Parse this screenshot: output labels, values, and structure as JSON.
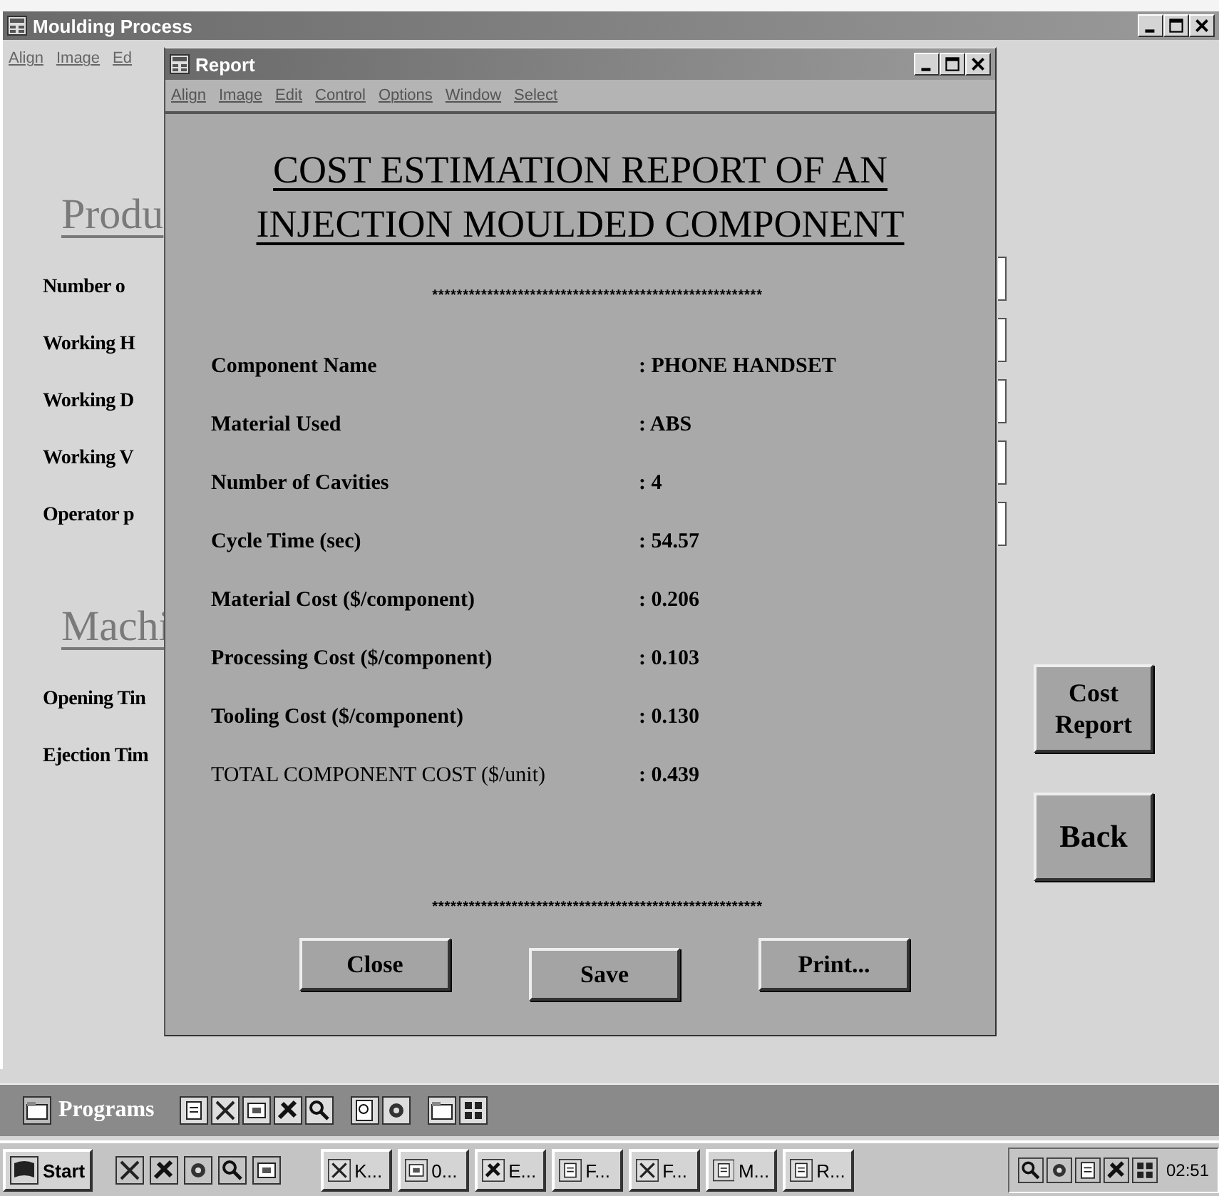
{
  "main_window": {
    "title": "Moulding Process",
    "menu": [
      "Align",
      "Image",
      "Ed"
    ],
    "sections": [
      {
        "heading": "Produ",
        "labels": [
          "Number o",
          "Working H",
          "Working D",
          "Working V",
          "Operator p"
        ]
      },
      {
        "heading": "Machi",
        "labels": [
          "Opening Tin",
          "Ejection Tim"
        ]
      }
    ],
    "buttons": [
      "Cost Report",
      "Back"
    ]
  },
  "report": {
    "title": "Report",
    "menu": [
      "Align",
      "Image",
      "Edit",
      "Control",
      "Options",
      "Window",
      "Select"
    ],
    "heading_lines": [
      "COST ESTIMATION REPORT OF AN",
      "INJECTION MOULDED COMPONENT"
    ],
    "separator_top": "******************************************************",
    "rows": [
      {
        "label": "Component Name",
        "value": ": PHONE HANDSET",
        "bold": true
      },
      {
        "label": "Material Used",
        "value": ": ABS",
        "bold": true
      },
      {
        "label": "Number of Cavities",
        "value": ": 4",
        "bold": true
      },
      {
        "label": "Cycle Time (sec)",
        "value": ": 54.57",
        "bold": true
      },
      {
        "label": "Material Cost ($/component)",
        "value": ": 0.206",
        "bold": true
      },
      {
        "label": "Processing Cost ($/component)",
        "value": ": 0.103",
        "bold": true
      },
      {
        "label": "Tooling Cost ($/component)",
        "value": ": 0.130",
        "bold": true
      },
      {
        "label": "TOTAL COMPONENT COST ($/unit)",
        "value": ": 0.439",
        "bold": false
      }
    ],
    "separator_bottom": "******************************************************",
    "buttons": [
      "Close",
      "Save",
      "Print..."
    ]
  },
  "quick_launch": {
    "label": "Programs"
  },
  "taskbar": {
    "start": "Start",
    "tasks": [
      "K...",
      "0...",
      "E...",
      "F...",
      "F...",
      "M...",
      "R..."
    ],
    "clock": "02:51"
  }
}
